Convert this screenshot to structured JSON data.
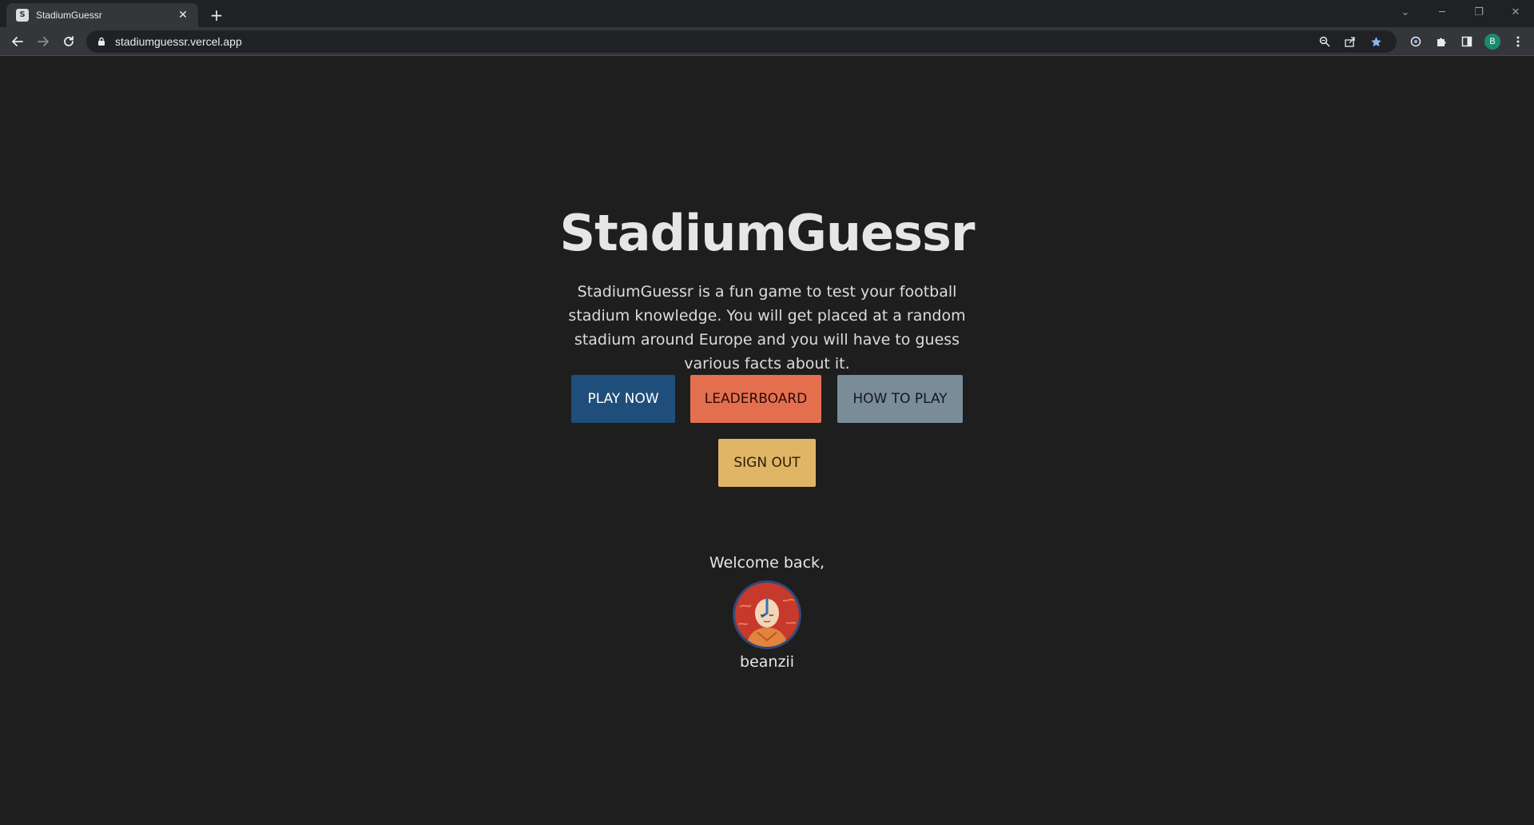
{
  "browser": {
    "tab_title": "StadiumGuessr",
    "favicon_letter": "S",
    "url": "stadiumguessr.vercel.app",
    "profile_initial": "B"
  },
  "page": {
    "title": "StadiumGuessr",
    "description": "StadiumGuessr is a fun game to test your football stadium knowledge. You will get placed at a random stadium around Europe and you will have to guess various facts about it.",
    "buttons": {
      "play_now": "PLAY NOW",
      "leaderboard": "LEADERBOARD",
      "how_to_play": "HOW TO PLAY",
      "sign_out": "SIGN OUT"
    },
    "welcome": "Welcome back,",
    "username": "beanzii"
  },
  "colors": {
    "background": "#1e1e1e",
    "play_now": "#1f4e7a",
    "leaderboard": "#e46f4f",
    "how_to_play": "#7b8c99",
    "sign_out": "#e0b565",
    "bookmark_star": "#8ab4f8",
    "profile_avatar": "#1a8a6e"
  }
}
